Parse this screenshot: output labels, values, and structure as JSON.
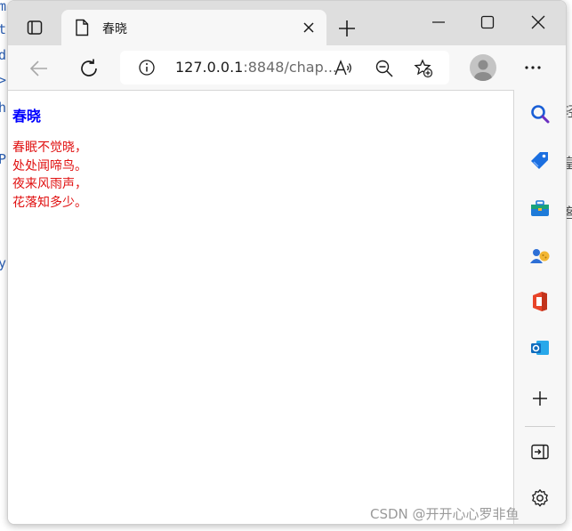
{
  "background_editor": {
    "left_glyphs": [
      "m",
      "t",
      "d",
      ">",
      "h",
      "P",
      "y"
    ],
    "right_glyphs": [
      "轻",
      "皇",
      "客"
    ]
  },
  "tab": {
    "title": "春晓",
    "page_icon": "page-icon",
    "close_icon": "close-icon"
  },
  "titlebar": {
    "tab_actions_icon": "tab-actions-icon",
    "new_tab_icon": "plus-icon",
    "minimize_icon": "minimize-icon",
    "maximize_icon": "maximize-icon",
    "close_icon": "close-icon"
  },
  "toolbar": {
    "back_icon": "back-arrow-icon",
    "refresh_icon": "refresh-icon",
    "address_host": "127.0.0.1",
    "address_rest": ":8848/chap...",
    "read_aloud_icon": "read-aloud-icon",
    "zoom_icon": "zoom-out-icon",
    "favorites_icon": "add-favorite-icon",
    "profile_icon": "profile-avatar",
    "more_icon": "more-icon"
  },
  "page": {
    "heading": "春晓",
    "poem_lines": [
      "春眠不觉晓，",
      "处处闻啼鸟。",
      "夜来风雨声，",
      "花落知多少。"
    ]
  },
  "sidebar": {
    "items": [
      "search-icon",
      "shopping-tag-icon",
      "tools-icon",
      "games-icon",
      "office-icon",
      "outlook-icon",
      "plus-icon",
      "hide-sidebar-icon",
      "settings-icon"
    ]
  },
  "watermark": "CSDN @开开心心罗非鱼",
  "colors": {
    "heading": "#0000ff",
    "poem": "#e01010",
    "titlebar": "#dedede",
    "toolbar": "#f7f7f7"
  }
}
